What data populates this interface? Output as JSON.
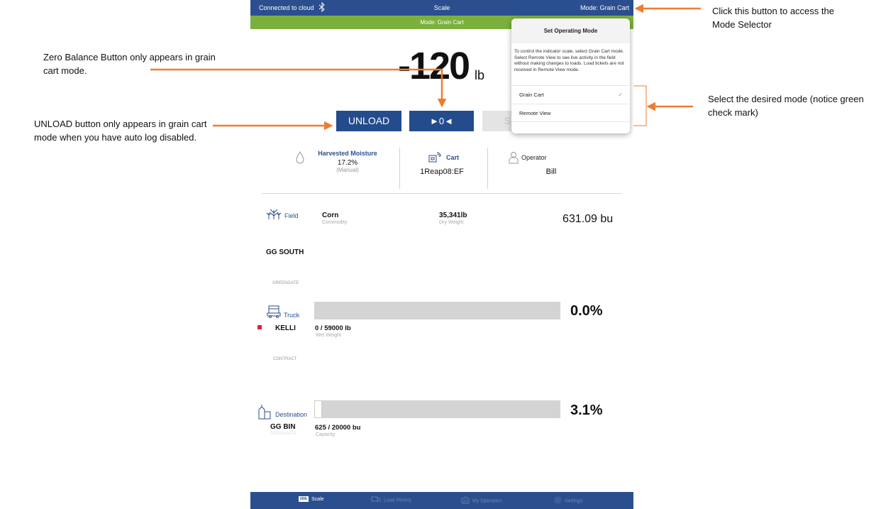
{
  "app": {
    "topbar": {
      "connection_status": "Connected to cloud",
      "title": "Scale",
      "mode_button": "Mode: Grain Cart"
    },
    "mode_banner": "Mode: Grain Cart",
    "weight": {
      "value": "-120",
      "unit": "lb"
    },
    "buttons": {
      "unload": "UNLOAD",
      "zero_balance": "►0◄",
      "send": "SEN"
    },
    "info": {
      "moisture": {
        "label": "Harvested Moisture",
        "value": "17.2%",
        "note": "(Manual)"
      },
      "cart": {
        "label": "Cart",
        "value": "1Reap08:EF"
      },
      "operator": {
        "label": "Operator",
        "value": "Bill"
      }
    },
    "field": {
      "label": "Field",
      "name": "GG SOUTH",
      "farm": "GREENGATE",
      "commodity": {
        "value": "Corn",
        "label": "Commodity"
      },
      "dry_weight": {
        "value": "35,341lb",
        "label": "Dry Weight"
      },
      "bushels": "631.09 bu"
    },
    "truck": {
      "label": "Truck",
      "name": "KELLI",
      "type": "CONTRACT",
      "fill_percent_text": "0.0%",
      "fill_fraction": 0.0,
      "weight_text": "0 / 59000 lb",
      "weight_label": "Wet Weight",
      "status_color": "#d9262c"
    },
    "destination": {
      "label": "Destination",
      "name": "GG BIN",
      "farm": "GREENGATE",
      "fill_percent_text": "3.1%",
      "fill_fraction": 0.031,
      "capacity_text": "625 / 20000 bu",
      "capacity_label": "Capacity"
    },
    "nav": [
      {
        "label": "Scale",
        "icon": "scale-icon",
        "badge": "00lb",
        "active": true
      },
      {
        "label": "Load History",
        "icon": "truck-icon",
        "active": false
      },
      {
        "label": "My Operation",
        "icon": "operation-icon",
        "active": false
      },
      {
        "label": "Settings",
        "icon": "gear-icon",
        "active": false
      }
    ],
    "popover": {
      "title": "Set Operating Mode",
      "description": "To control the indicator scale, select Grain Cart mode.  Select Remote View to see live activity in the field without making changes to loads.  Load tickets are not received in Remote View mode.",
      "options": [
        {
          "label": "Grain Cart",
          "selected": true
        },
        {
          "label": "Remote View",
          "selected": false
        }
      ]
    }
  },
  "annotations": {
    "zero_balance": "Zero Balance Button only appears in grain cart mode.",
    "unload": "UNLOAD button only appears in grain cart mode when you have auto log disabled.",
    "mode_selector": "Click this button to access the Mode Selector",
    "select_mode": "Select the desired mode (notice green check mark)"
  },
  "colors": {
    "primary_blue": "#2b4f8e",
    "mode_green": "#7bb03c",
    "arrow_orange": "#ed7d31",
    "progress_gray": "#d4d4d4"
  }
}
